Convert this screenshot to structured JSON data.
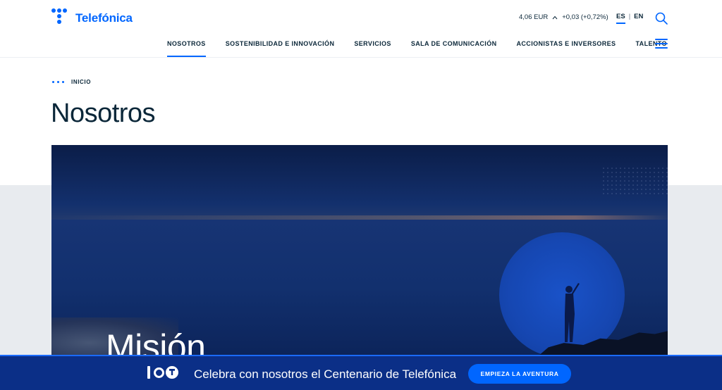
{
  "brand": {
    "name": "Telefónica",
    "accent": "#0066ff"
  },
  "stock": {
    "price": "4,06 EUR",
    "change": "+0,03 (+0,72%)"
  },
  "lang": {
    "es": "ES",
    "separator": "|",
    "en": "EN"
  },
  "nav": {
    "items": [
      {
        "label": "NOSOTROS",
        "active": true
      },
      {
        "label": "SOSTENIBILIDAD E INNOVACIÓN"
      },
      {
        "label": "SERVICIOS"
      },
      {
        "label": "SALA DE COMUNICACIÓN"
      },
      {
        "label": "ACCIONISTAS E INVERSORES"
      },
      {
        "label": "TALENTO"
      }
    ]
  },
  "breadcrumb": {
    "label": "INICIO"
  },
  "page": {
    "title": "Nosotros"
  },
  "hero": {
    "heading": "Misión"
  },
  "banner": {
    "text": "Celebra con nosotros el Centenario de Telefónica",
    "button": "EMPIEZA LA AVENTURA"
  },
  "icons": [
    "logo-mark-icon",
    "caret-up-icon",
    "search-icon",
    "hamburger-menu-icon",
    "breadcrumb-dots-icon",
    "centenary-logo-icon"
  ]
}
